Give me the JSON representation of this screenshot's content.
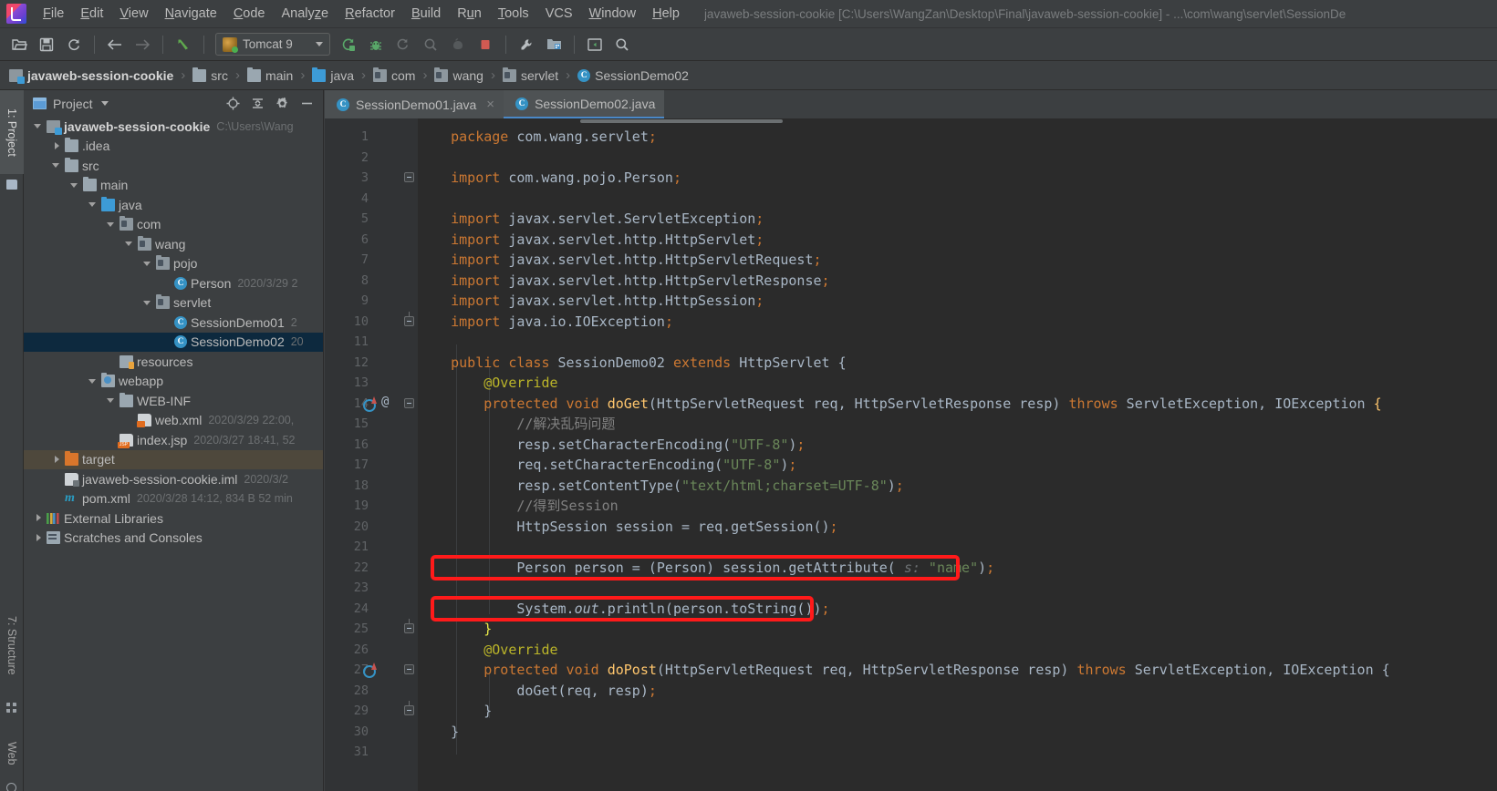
{
  "window": {
    "title": "javaweb-session-cookie [C:\\Users\\WangZan\\Desktop\\Final\\javaweb-session-cookie] - ...\\com\\wang\\servlet\\SessionDe",
    "logo_icon": "intellij-idea-logo"
  },
  "menubar": {
    "items": [
      {
        "label": "File",
        "mnemonic": "F"
      },
      {
        "label": "Edit",
        "mnemonic": "E"
      },
      {
        "label": "View",
        "mnemonic": "V"
      },
      {
        "label": "Navigate",
        "mnemonic": "N"
      },
      {
        "label": "Code",
        "mnemonic": "C"
      },
      {
        "label": "Analyze",
        "mnemonic": "z"
      },
      {
        "label": "Refactor",
        "mnemonic": "R"
      },
      {
        "label": "Build",
        "mnemonic": "B"
      },
      {
        "label": "Run",
        "mnemonic": "u"
      },
      {
        "label": "Tools",
        "mnemonic": "T"
      },
      {
        "label": "VCS",
        "mnemonic": ""
      },
      {
        "label": "Window",
        "mnemonic": "W"
      },
      {
        "label": "Help",
        "mnemonic": "H"
      }
    ]
  },
  "toolbar": {
    "buttons": [
      {
        "name": "open-project-icon",
        "glyph": "📂"
      },
      {
        "name": "save-all-icon",
        "glyph": "💾"
      },
      {
        "name": "sync-refresh-icon",
        "glyph": "↻"
      },
      {
        "name": "back-arrow-icon",
        "glyph": "←"
      },
      {
        "name": "forward-arrow-icon",
        "glyph": "→"
      },
      {
        "name": "undo-icon",
        "glyph": "↖"
      }
    ],
    "run_config": {
      "label": "Tomcat 9",
      "icon": "tomcat-icon"
    },
    "run_buttons": [
      {
        "name": "run-icon",
        "glyph": "▶"
      },
      {
        "name": "debug-icon",
        "glyph": "🐞"
      },
      {
        "name": "run-with-coverage-icon",
        "glyph": "▷"
      },
      {
        "name": "profile-icon",
        "glyph": "◎"
      },
      {
        "name": "attach-debugger-icon",
        "glyph": "⬤"
      },
      {
        "name": "stop-icon",
        "glyph": "■"
      }
    ],
    "right_buttons": [
      {
        "name": "settings-wrench-icon",
        "glyph": "🔧"
      },
      {
        "name": "project-structure-icon",
        "glyph": "🗂"
      },
      {
        "name": "terminal-icon",
        "glyph": "▣"
      },
      {
        "name": "search-everywhere-icon",
        "glyph": "🔍"
      }
    ]
  },
  "breadcrumb": {
    "items": [
      {
        "label": "javaweb-session-cookie",
        "icon": "module-icon",
        "bold": true
      },
      {
        "label": "src",
        "icon": "folder-icon",
        "bold": false
      },
      {
        "label": "main",
        "icon": "folder-icon",
        "bold": false
      },
      {
        "label": "java",
        "icon": "folder-blue-icon",
        "bold": false
      },
      {
        "label": "com",
        "icon": "package-icon",
        "bold": false
      },
      {
        "label": "wang",
        "icon": "package-icon",
        "bold": false
      },
      {
        "label": "servlet",
        "icon": "package-icon",
        "bold": false
      },
      {
        "label": "SessionDemo02",
        "icon": "class-icon",
        "bold": false
      }
    ],
    "separator": "›"
  },
  "stripe": {
    "project_button": "1: Project",
    "structure_button": "7: Structure",
    "web_button": "Web"
  },
  "project_panel": {
    "title": "Project",
    "actions": [
      {
        "name": "locate-target-icon"
      },
      {
        "name": "collapse-all-icon"
      },
      {
        "name": "gear-settings-icon"
      },
      {
        "name": "hide-panel-icon"
      }
    ],
    "tree": [
      {
        "label": "javaweb-session-cookie",
        "meta": "C:\\Users\\Wang",
        "indent": 0,
        "twist": "open",
        "icon": "module",
        "bold": true,
        "state": "normal"
      },
      {
        "label": ".idea",
        "meta": "",
        "indent": 1,
        "twist": "closed",
        "icon": "folder",
        "bold": false,
        "state": "normal"
      },
      {
        "label": "src",
        "meta": "",
        "indent": 1,
        "twist": "open",
        "icon": "folder",
        "bold": false,
        "state": "normal"
      },
      {
        "label": "main",
        "meta": "",
        "indent": 2,
        "twist": "open",
        "icon": "folder",
        "bold": false,
        "state": "normal"
      },
      {
        "label": "java",
        "meta": "",
        "indent": 3,
        "twist": "open",
        "icon": "folder-blue",
        "bold": false,
        "state": "normal"
      },
      {
        "label": "com",
        "meta": "",
        "indent": 4,
        "twist": "open",
        "icon": "pkg",
        "bold": false,
        "state": "normal"
      },
      {
        "label": "wang",
        "meta": "",
        "indent": 5,
        "twist": "open",
        "icon": "pkg",
        "bold": false,
        "state": "normal"
      },
      {
        "label": "pojo",
        "meta": "",
        "indent": 6,
        "twist": "open",
        "icon": "pkg",
        "bold": false,
        "state": "normal"
      },
      {
        "label": "Person",
        "meta": "2020/3/29 2",
        "indent": 7,
        "twist": "none",
        "icon": "cls",
        "bold": false,
        "state": "normal"
      },
      {
        "label": "servlet",
        "meta": "",
        "indent": 6,
        "twist": "open",
        "icon": "pkg",
        "bold": false,
        "state": "normal"
      },
      {
        "label": "SessionDemo01",
        "meta": "2",
        "indent": 7,
        "twist": "none",
        "icon": "cls",
        "bold": false,
        "state": "normal"
      },
      {
        "label": "SessionDemo02",
        "meta": "20",
        "indent": 7,
        "twist": "none",
        "icon": "cls",
        "bold": false,
        "state": "selected"
      },
      {
        "label": "resources",
        "meta": "",
        "indent": 4,
        "twist": "none",
        "icon": "res",
        "bold": false,
        "state": "normal"
      },
      {
        "label": "webapp",
        "meta": "",
        "indent": 3,
        "twist": "open",
        "icon": "webf",
        "bold": false,
        "state": "normal"
      },
      {
        "label": "WEB-INF",
        "meta": "",
        "indent": 4,
        "twist": "open",
        "icon": "folder",
        "bold": false,
        "state": "normal"
      },
      {
        "label": "web.xml",
        "meta": "2020/3/29 22:00,",
        "indent": 5,
        "twist": "none",
        "icon": "xml",
        "bold": false,
        "state": "normal"
      },
      {
        "label": "index.jsp",
        "meta": "2020/3/27 18:41, 52",
        "indent": 4,
        "twist": "none",
        "icon": "jsp",
        "bold": false,
        "state": "normal"
      },
      {
        "label": "target",
        "meta": "",
        "indent": 1,
        "twist": "closed",
        "icon": "folder-orange",
        "bold": false,
        "state": "highlight"
      },
      {
        "label": "javaweb-session-cookie.iml",
        "meta": "2020/3/2",
        "indent": 1,
        "twist": "none",
        "icon": "iml",
        "bold": false,
        "state": "normal"
      },
      {
        "label": "pom.xml",
        "meta": "2020/3/28 14:12, 834 B 52 min",
        "indent": 1,
        "twist": "none",
        "icon": "maven",
        "bold": false,
        "state": "normal"
      },
      {
        "label": "External Libraries",
        "meta": "",
        "indent": 0,
        "twist": "closed",
        "icon": "libs",
        "bold": false,
        "state": "normal"
      },
      {
        "label": "Scratches and Consoles",
        "meta": "",
        "indent": 0,
        "twist": "closed",
        "icon": "scratch",
        "bold": false,
        "state": "normal"
      }
    ]
  },
  "editor": {
    "tabs": [
      {
        "label": "SessionDemo01.java",
        "icon": "class-icon",
        "active": false,
        "close": "×"
      },
      {
        "label": "SessionDemo02.java",
        "icon": "class-icon",
        "active": true,
        "close": ""
      }
    ],
    "first_line": 1,
    "last_line": 31,
    "lines": [
      {
        "n": 1,
        "segments": [
          {
            "t": "    ",
            "c": ""
          },
          {
            "t": "package",
            "c": "kw"
          },
          {
            "t": " com.wang.servlet",
            "c": ""
          },
          {
            "t": ";",
            "c": "kw"
          }
        ]
      },
      {
        "n": 2,
        "segments": []
      },
      {
        "n": 3,
        "segments": [
          {
            "t": "    ",
            "c": ""
          },
          {
            "t": "import",
            "c": "kw"
          },
          {
            "t": " com.wang.pojo.Person",
            "c": ""
          },
          {
            "t": ";",
            "c": "kw"
          }
        ]
      },
      {
        "n": 4,
        "segments": []
      },
      {
        "n": 5,
        "segments": [
          {
            "t": "    ",
            "c": ""
          },
          {
            "t": "import",
            "c": "kw"
          },
          {
            "t": " javax.servlet.ServletException",
            "c": ""
          },
          {
            "t": ";",
            "c": "kw"
          }
        ]
      },
      {
        "n": 6,
        "segments": [
          {
            "t": "    ",
            "c": ""
          },
          {
            "t": "import",
            "c": "kw"
          },
          {
            "t": " javax.servlet.http.HttpServlet",
            "c": ""
          },
          {
            "t": ";",
            "c": "kw"
          }
        ]
      },
      {
        "n": 7,
        "segments": [
          {
            "t": "    ",
            "c": ""
          },
          {
            "t": "import",
            "c": "kw"
          },
          {
            "t": " javax.servlet.http.HttpServletRequest",
            "c": ""
          },
          {
            "t": ";",
            "c": "kw"
          }
        ]
      },
      {
        "n": 8,
        "segments": [
          {
            "t": "    ",
            "c": ""
          },
          {
            "t": "import",
            "c": "kw"
          },
          {
            "t": " javax.servlet.http.HttpServletResponse",
            "c": ""
          },
          {
            "t": ";",
            "c": "kw"
          }
        ]
      },
      {
        "n": 9,
        "segments": [
          {
            "t": "    ",
            "c": ""
          },
          {
            "t": "import",
            "c": "kw"
          },
          {
            "t": " javax.servlet.http.HttpSession",
            "c": ""
          },
          {
            "t": ";",
            "c": "kw"
          }
        ]
      },
      {
        "n": 10,
        "segments": [
          {
            "t": "    ",
            "c": ""
          },
          {
            "t": "import",
            "c": "kw"
          },
          {
            "t": " java.io.IOException",
            "c": ""
          },
          {
            "t": ";",
            "c": "kw"
          }
        ]
      },
      {
        "n": 11,
        "segments": []
      },
      {
        "n": 12,
        "segments": [
          {
            "t": "    ",
            "c": ""
          },
          {
            "t": "public class",
            "c": "kw"
          },
          {
            "t": " SessionDemo02 ",
            "c": ""
          },
          {
            "t": "extends",
            "c": "kw"
          },
          {
            "t": " HttpServlet {",
            "c": ""
          }
        ]
      },
      {
        "n": 13,
        "segments": [
          {
            "t": "        ",
            "c": ""
          },
          {
            "t": "@Override",
            "c": "ann"
          }
        ]
      },
      {
        "n": 14,
        "segments": [
          {
            "t": "        ",
            "c": ""
          },
          {
            "t": "protected void",
            "c": "kw"
          },
          {
            "t": " ",
            "c": ""
          },
          {
            "t": "doGet",
            "c": "fn"
          },
          {
            "t": "(HttpServletRequest req, HttpServletResponse resp) ",
            "c": ""
          },
          {
            "t": "throws",
            "c": "kw"
          },
          {
            "t": " ServletException, IOException ",
            "c": ""
          },
          {
            "t": "{",
            "c": "brace-hl"
          }
        ]
      },
      {
        "n": 15,
        "segments": [
          {
            "t": "            ",
            "c": ""
          },
          {
            "t": "//解决乱码问题",
            "c": "cmt"
          }
        ]
      },
      {
        "n": 16,
        "segments": [
          {
            "t": "            resp.setCharacterEncoding(",
            "c": ""
          },
          {
            "t": "\"UTF-8\"",
            "c": "str"
          },
          {
            "t": ")",
            "c": ""
          },
          {
            "t": ";",
            "c": "kw"
          }
        ]
      },
      {
        "n": 17,
        "segments": [
          {
            "t": "            req.setCharacterEncoding(",
            "c": ""
          },
          {
            "t": "\"UTF-8\"",
            "c": "str"
          },
          {
            "t": ")",
            "c": ""
          },
          {
            "t": ";",
            "c": "kw"
          }
        ]
      },
      {
        "n": 18,
        "segments": [
          {
            "t": "            resp.setContentType(",
            "c": ""
          },
          {
            "t": "\"text/html;charset=UTF-8\"",
            "c": "str"
          },
          {
            "t": ")",
            "c": ""
          },
          {
            "t": ";",
            "c": "kw"
          }
        ]
      },
      {
        "n": 19,
        "segments": [
          {
            "t": "            ",
            "c": ""
          },
          {
            "t": "//得到Session",
            "c": "cmt"
          }
        ]
      },
      {
        "n": 20,
        "segments": [
          {
            "t": "            HttpSession session = req.getSession()",
            "c": ""
          },
          {
            "t": ";",
            "c": "kw"
          }
        ]
      },
      {
        "n": 21,
        "segments": []
      },
      {
        "n": 22,
        "segments": [
          {
            "t": "            Person person = (Person) session.getAttribute( ",
            "c": ""
          },
          {
            "t": "s:",
            "c": "hint"
          },
          {
            "t": " ",
            "c": ""
          },
          {
            "t": "\"name\"",
            "c": "str"
          },
          {
            "t": ")",
            "c": ""
          },
          {
            "t": ";",
            "c": "kw"
          }
        ]
      },
      {
        "n": 23,
        "segments": []
      },
      {
        "n": 24,
        "segments": [
          {
            "t": "            System.",
            "c": ""
          },
          {
            "t": "out",
            "c": "italic"
          },
          {
            "t": ".println(person.toString())",
            "c": ""
          },
          {
            "t": ";",
            "c": "kw"
          }
        ]
      },
      {
        "n": 25,
        "segments": [
          {
            "t": "        ",
            "c": ""
          },
          {
            "t": "}",
            "c": "brace-y"
          }
        ]
      },
      {
        "n": 26,
        "segments": [
          {
            "t": "        ",
            "c": ""
          },
          {
            "t": "@Override",
            "c": "ann"
          }
        ]
      },
      {
        "n": 27,
        "segments": [
          {
            "t": "        ",
            "c": ""
          },
          {
            "t": "protected void",
            "c": "kw"
          },
          {
            "t": " ",
            "c": ""
          },
          {
            "t": "doPost",
            "c": "fn"
          },
          {
            "t": "(HttpServletRequest req, HttpServletResponse resp) ",
            "c": ""
          },
          {
            "t": "throws",
            "c": "kw"
          },
          {
            "t": " ServletException, IOException {",
            "c": ""
          }
        ]
      },
      {
        "n": 28,
        "segments": [
          {
            "t": "            doGet(req, resp)",
            "c": ""
          },
          {
            "t": ";",
            "c": "kw"
          }
        ]
      },
      {
        "n": 29,
        "segments": [
          {
            "t": "        }",
            "c": ""
          }
        ]
      },
      {
        "n": 30,
        "segments": [
          {
            "t": "    }",
            "c": ""
          }
        ]
      },
      {
        "n": 31,
        "segments": []
      }
    ],
    "annotations": [
      {
        "name": "red-highlight-box-getattribute",
        "line": 22
      },
      {
        "name": "red-highlight-box-println",
        "line": 24
      }
    ],
    "gutter_marks": [
      {
        "line": 14,
        "name": "override-method-marker",
        "extra": "@"
      },
      {
        "line": 27,
        "name": "override-method-marker",
        "extra": ""
      }
    ]
  },
  "colors": {
    "accent_red": "#ff1a1a",
    "editor_bg": "#2b2b2b",
    "panel_bg": "#3c3f41",
    "gutter_bg": "#313335",
    "selection_blue": "#0d293e",
    "keyword_orange": "#cc7832",
    "string_green": "#6a8759",
    "method_yellow": "#ffc66d",
    "annotation_yellow": "#bbb529",
    "text_gray": "#a9b7c6"
  }
}
